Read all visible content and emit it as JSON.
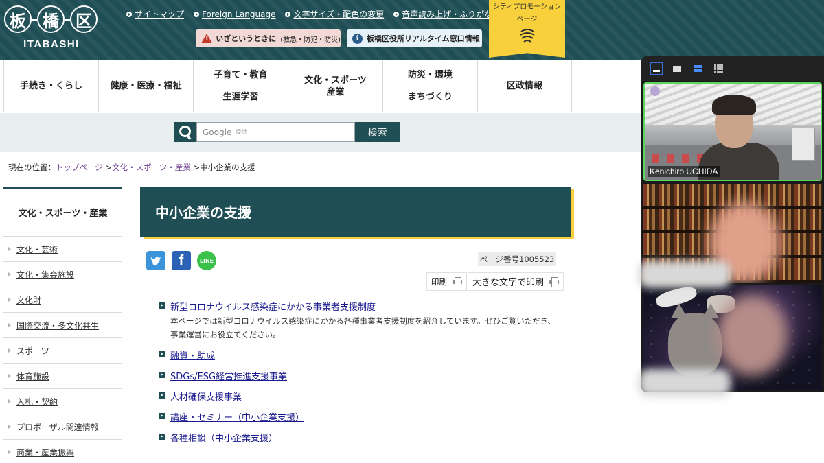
{
  "header": {
    "logo": {
      "kanji": [
        "板",
        "橋",
        "区"
      ],
      "roman": "ITABASHI"
    },
    "top_links": [
      "サイトマップ",
      "Foreign Language",
      "文字サイズ・配色の変更",
      "音声読み上げ・ふりがな"
    ],
    "emergency": {
      "main": "いざというときに",
      "sub": "(救急・防犯・防災)"
    },
    "realtime": "板橋区役所リアルタイム窓口情報",
    "promo": {
      "line1": "シティプロモーション",
      "line2": "ページ"
    }
  },
  "nav": [
    {
      "lines": [
        "手続き・くらし"
      ]
    },
    {
      "lines": [
        "健康・医療・福祉"
      ]
    },
    {
      "lines": [
        "子育て・教育",
        "生涯学習"
      ]
    },
    {
      "lines": [
        "文化・スポーツ",
        "産業"
      ]
    },
    {
      "lines": [
        "防災・環境",
        "まちづくり"
      ]
    },
    {
      "lines": [
        "区政情報"
      ]
    }
  ],
  "search": {
    "placeholder": "Google",
    "provided": "提供",
    "button": "検索"
  },
  "breadcrumb": {
    "prefix": "現在の位置：",
    "items": [
      "トップページ",
      "文化・スポーツ・産業"
    ],
    "current": "中小企業の支援",
    "sep": ">"
  },
  "sidebar": {
    "heading": "文化・スポーツ・産業",
    "items": [
      "文化・芸術",
      "文化・集会施設",
      "文化財",
      "国際交流・多文化共生",
      "スポーツ",
      "体育施設",
      "入札・契約",
      "プロポーザル関連情報",
      "商業・産業振興"
    ]
  },
  "main": {
    "title": "中小企業の支援",
    "social": {
      "line": "LINE"
    },
    "page_number": "ページ番号1005523",
    "print": "印刷",
    "print_large": "大きな文字で印刷",
    "links": [
      {
        "text": "新型コロナウイルス感染症にかかる事業者支援制度",
        "desc": "本ページでは新型コロナウイルス感染症にかかる各種事業者支援制度を紹介しています。ぜひご覧いただき、事業運営にお役立てください。"
      },
      {
        "text": "融資・助成"
      },
      {
        "text": "SDGs/ESG経営推進支援事業"
      },
      {
        "text": "人材確保支援事業"
      },
      {
        "text": "講座・セミナー（中小企業支援）"
      },
      {
        "text": "各種相談（中小企業支援）"
      }
    ]
  },
  "video_panel": {
    "participants": [
      {
        "name": "Kenichiro UCHIDA",
        "active_speaker": true
      },
      {
        "name": ""
      },
      {
        "name": ""
      }
    ],
    "colors": {
      "active_border": "#5cd65c"
    }
  },
  "colors": {
    "brand": "#1f4e55",
    "accent": "#f7d03c",
    "emergency_bg": "#f2d9d6",
    "link": "#1a1a8f"
  }
}
